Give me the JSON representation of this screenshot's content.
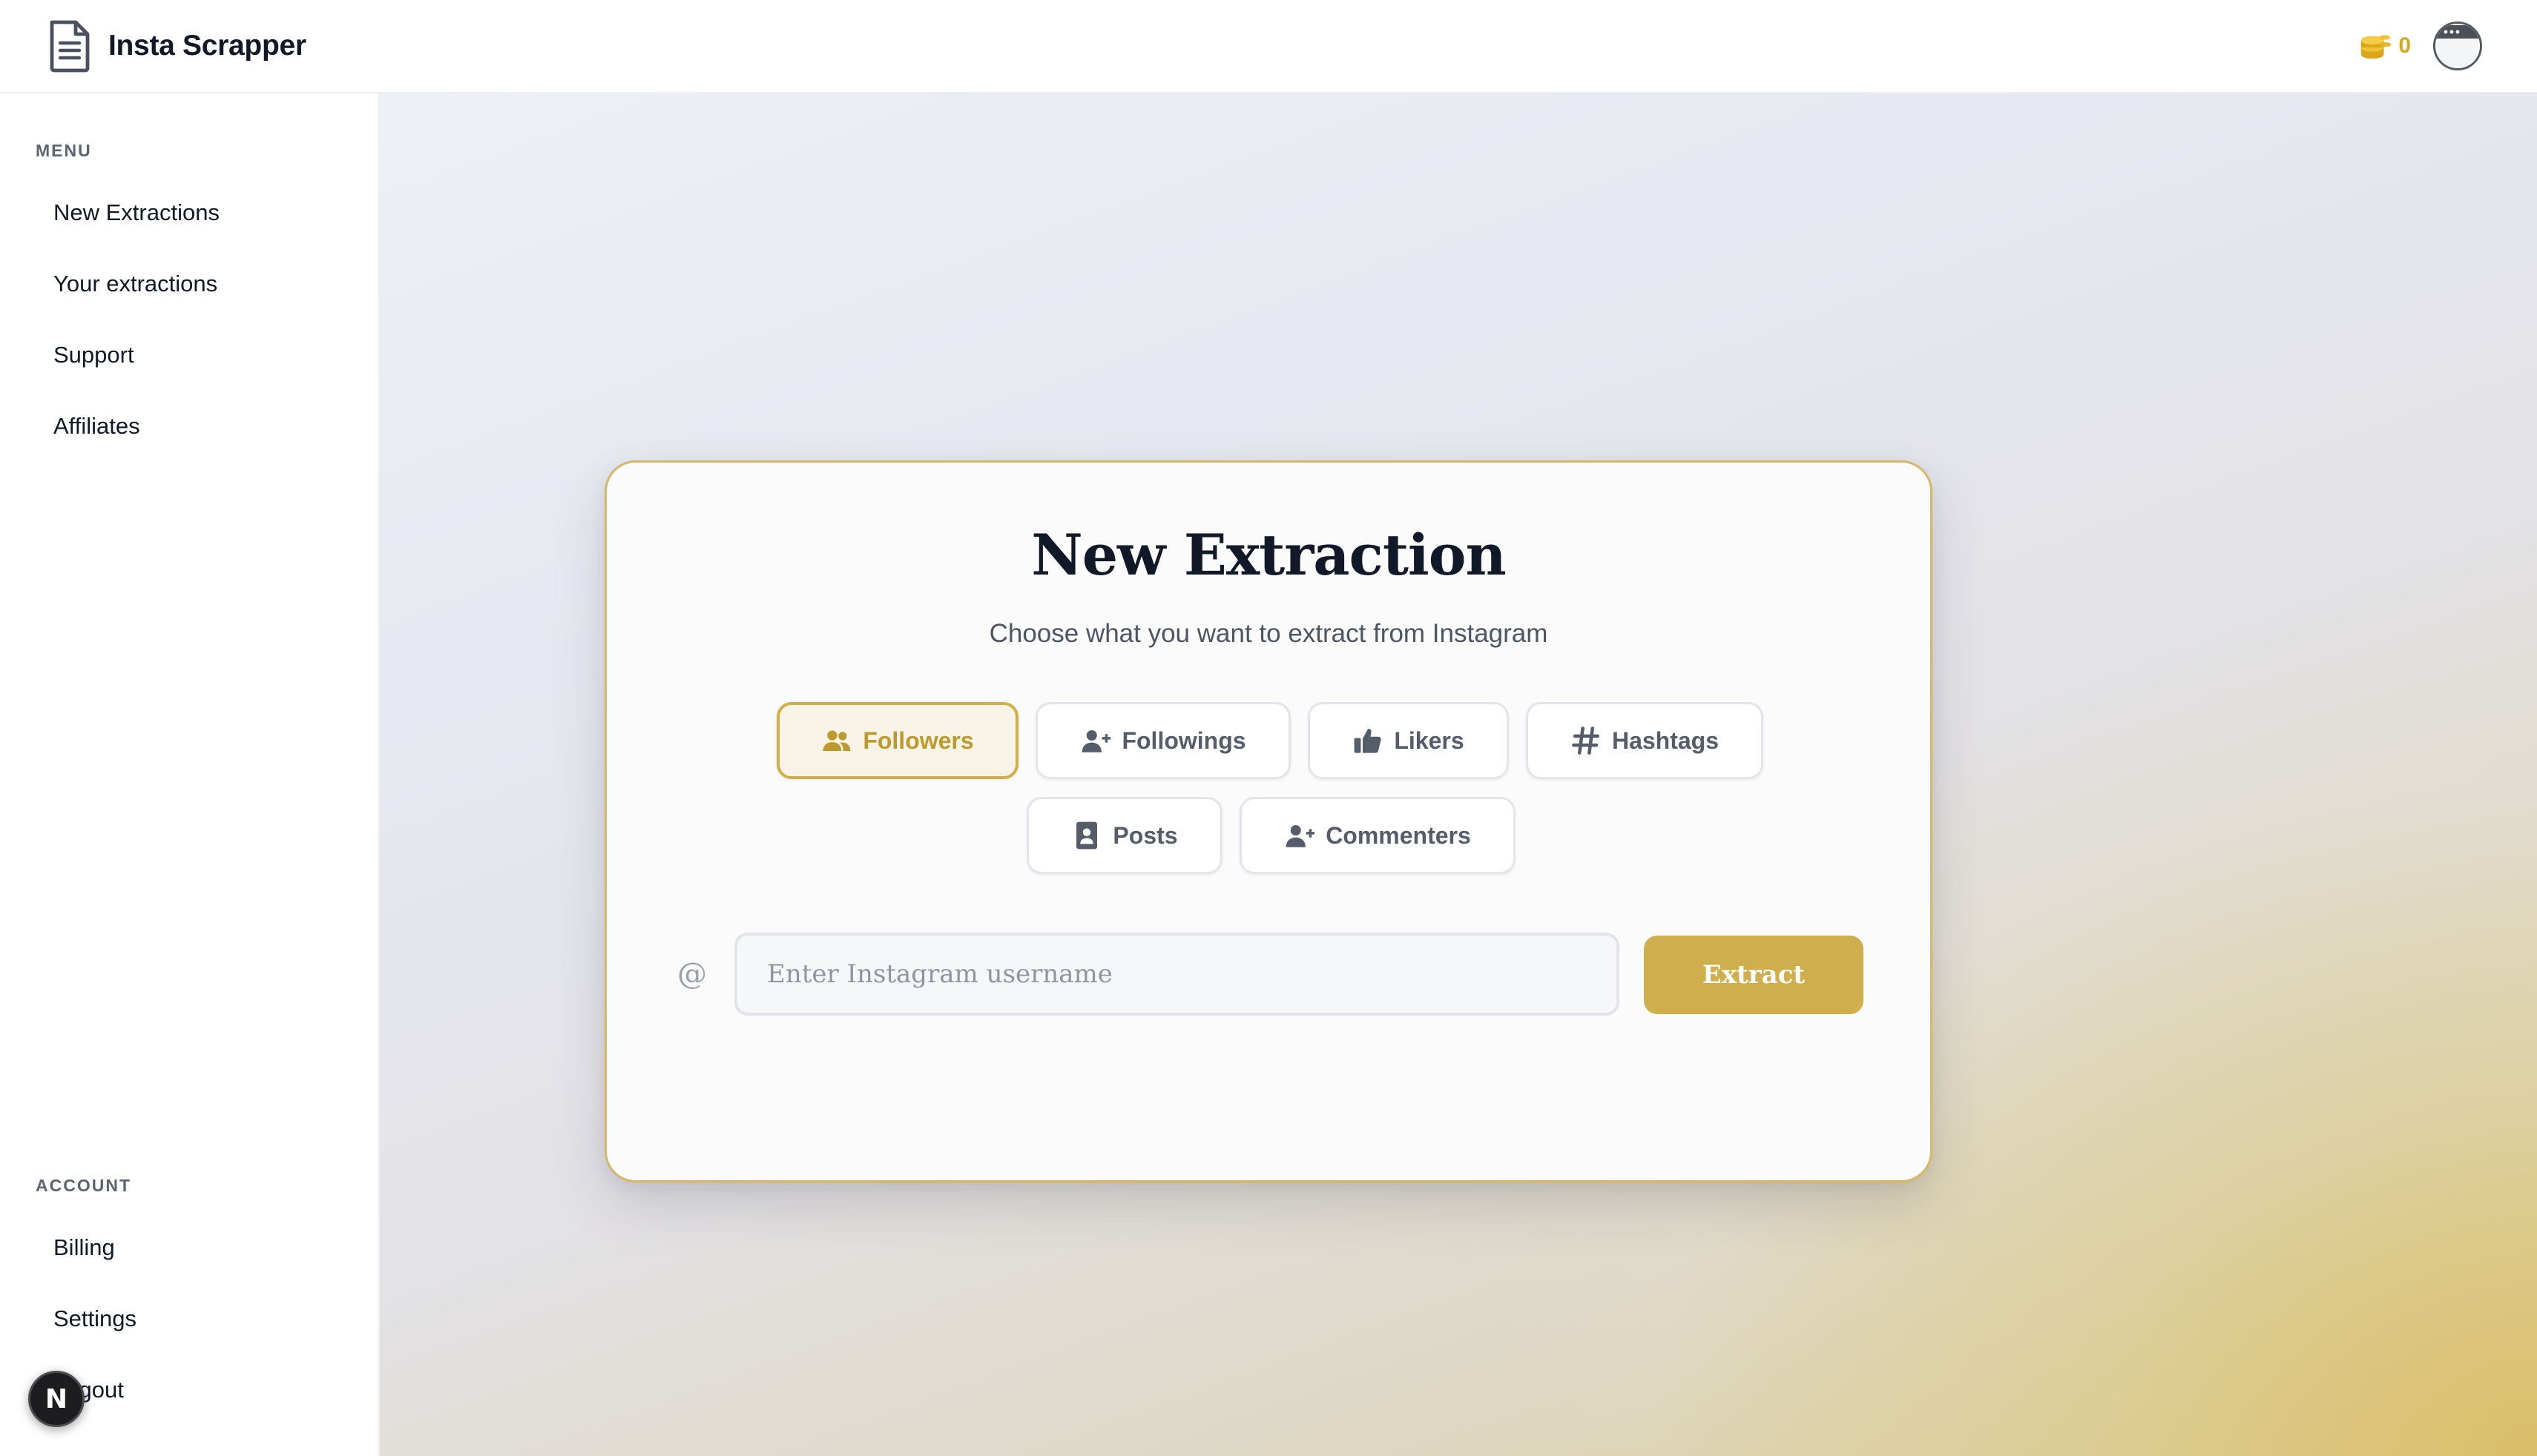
{
  "header": {
    "app_title": "Insta Scrapper",
    "logo_icon": "document-icon",
    "credits": "0",
    "credits_icon": "coins-icon",
    "avatar_icon": "browser-window-icon"
  },
  "sidebar": {
    "menu_label": "MENU",
    "menu_items": [
      {
        "label": "New Extractions"
      },
      {
        "label": "Your extractions"
      },
      {
        "label": "Support"
      },
      {
        "label": "Affiliates"
      }
    ],
    "account_label": "ACCOUNT",
    "account_items": [
      {
        "label": "Billing"
      },
      {
        "label": "Settings"
      },
      {
        "label": "Logout"
      }
    ],
    "fab_label": "N"
  },
  "card": {
    "title": "New Extraction",
    "subtitle": "Choose what you want to extract from Instagram",
    "types": [
      {
        "label": "Followers",
        "icon": "users-icon",
        "active": true
      },
      {
        "label": "Followings",
        "icon": "user-plus-icon",
        "active": false
      },
      {
        "label": "Likers",
        "icon": "thumbs-up-icon",
        "active": false
      },
      {
        "label": "Hashtags",
        "icon": "hashtag-icon",
        "active": false
      },
      {
        "label": "Posts",
        "icon": "post-icon",
        "active": false
      },
      {
        "label": "Commenters",
        "icon": "user-plus-icon",
        "active": false
      }
    ],
    "at_symbol": "@",
    "username_placeholder": "Enter Instagram username",
    "username_value": "",
    "extract_label": "Extract"
  },
  "colors": {
    "accent": "#cfae4d",
    "accent_text": "#bd9a2b",
    "credits": "#d4a81f"
  }
}
